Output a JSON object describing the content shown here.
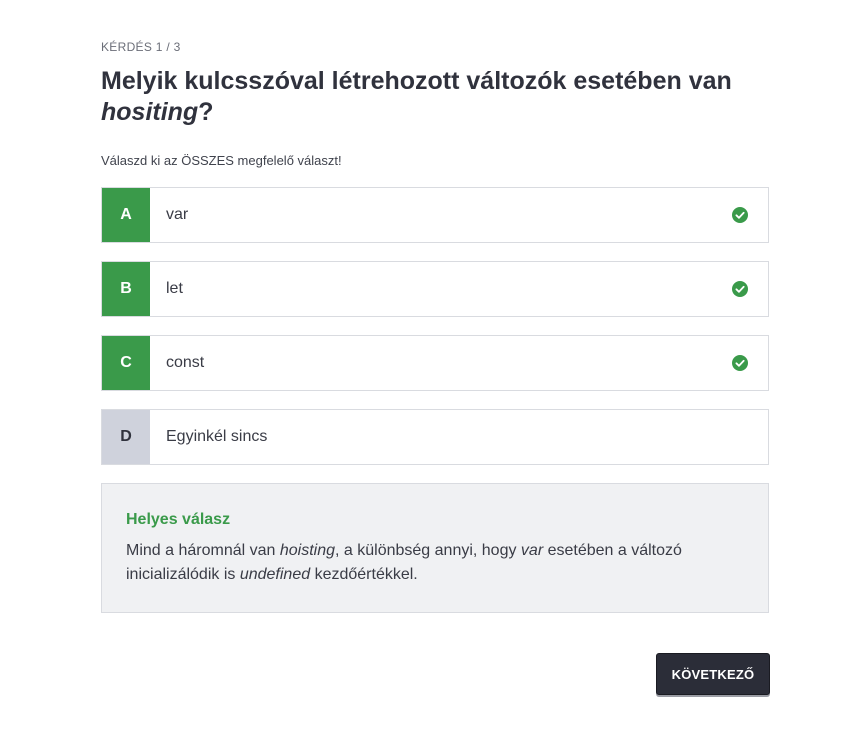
{
  "quiz": {
    "counter": "KÉRDÉS 1 / 3",
    "question": {
      "before": "Melyik kulcsszóval létrehozott változók esetében van ",
      "emphasis": "hositing",
      "after": "?"
    },
    "instructions": "Válaszd ki az ÖSSZES megfelelő választ!",
    "options": [
      {
        "letter": "A",
        "text": "var",
        "selected": true
      },
      {
        "letter": "B",
        "text": "let",
        "selected": true
      },
      {
        "letter": "C",
        "text": "const",
        "selected": true
      },
      {
        "letter": "D",
        "text": "Egyinkél sincs",
        "selected": false
      }
    ],
    "feedback": {
      "title": "Helyes válasz",
      "part1": "Mind a háromnál van ",
      "em1": "hoisting",
      "part2": ", a különbség annyi, hogy ",
      "em2": "var",
      "part3": " esetében a változó inicializálódik is ",
      "em3": "undefined",
      "part4": " kezdőértékkel."
    },
    "next_label": "KÖVETKEZŐ"
  },
  "colors": {
    "correct": "#3a9a4a",
    "unselected": "#cfd2dc",
    "button_bg": "#2b2d38",
    "feedback_bg": "#f0f1f3"
  },
  "icons": {
    "selected_indicator": "check-circle-icon"
  }
}
